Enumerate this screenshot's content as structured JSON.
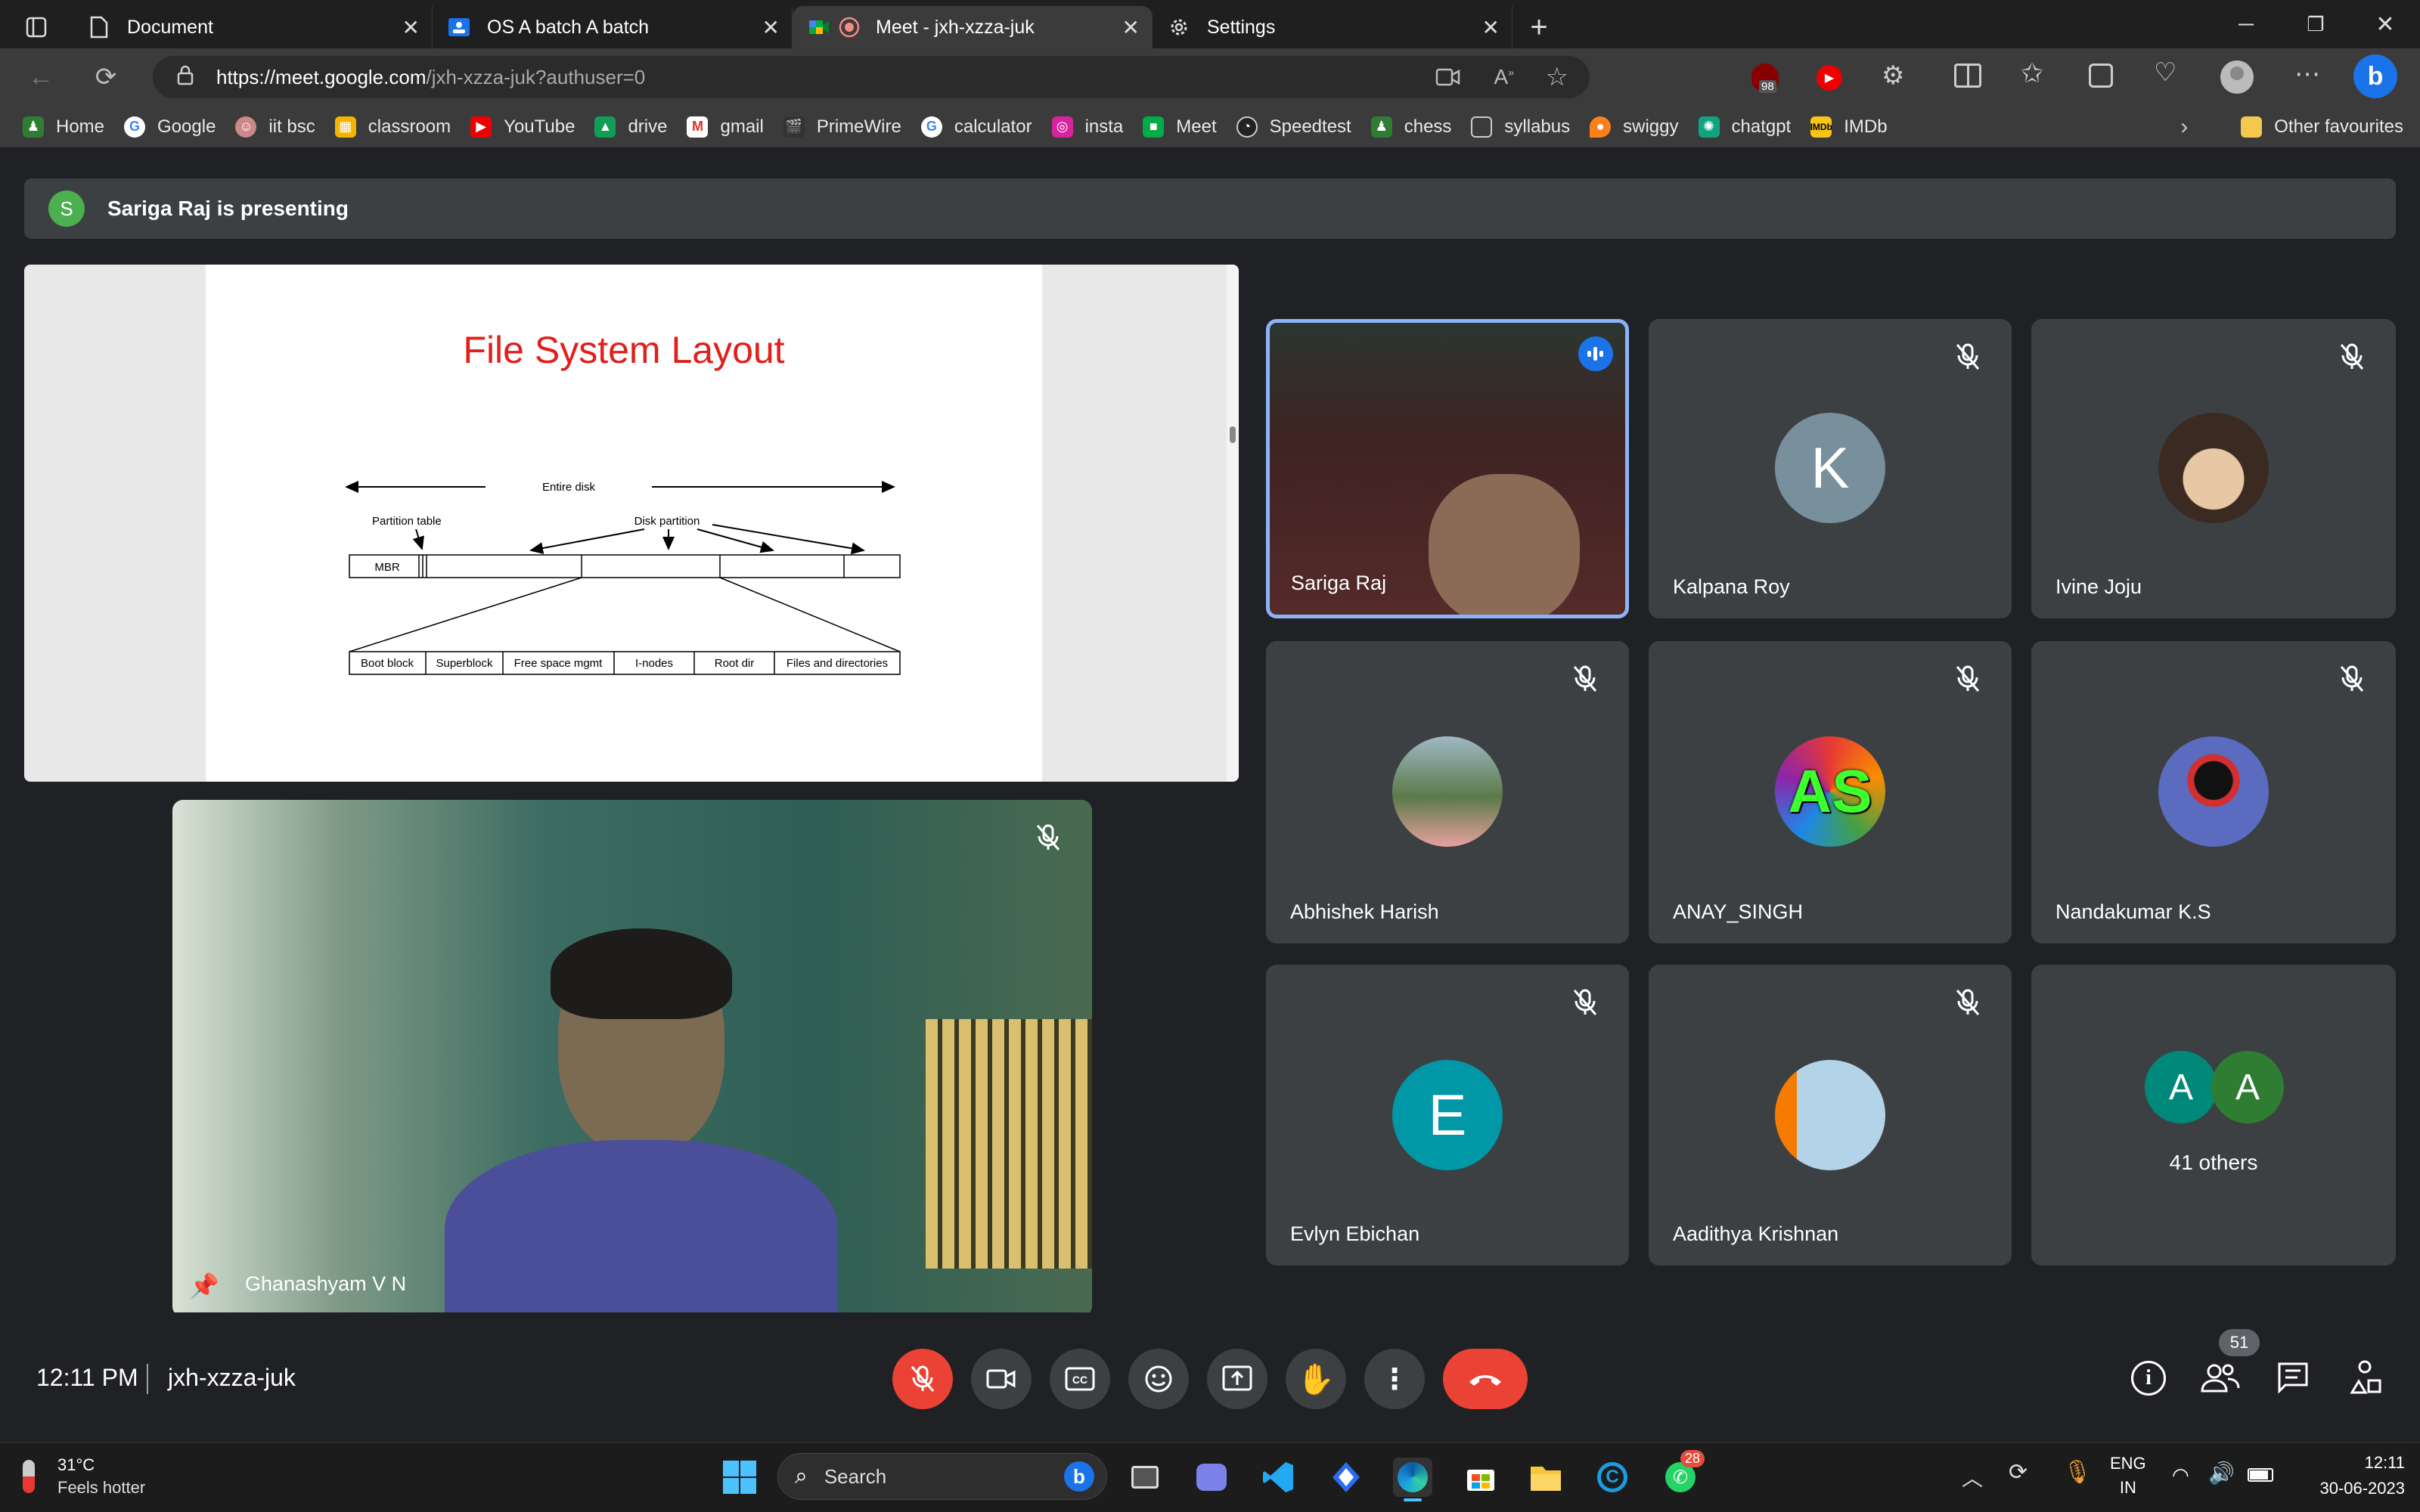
{
  "browser": {
    "tabs": [
      {
        "label": "Document",
        "icon": "document-icon"
      },
      {
        "label": "OS A batch A batch",
        "icon": "classroom-icon"
      },
      {
        "label": "Meet - jxh-xzza-juk",
        "icon": "meet-icon"
      },
      {
        "label": "Settings",
        "icon": "gear-icon"
      }
    ],
    "url_host": "https://meet.google.com",
    "url_path": "/jxh-xzza-juk?authuser=0",
    "ext_badge": "98",
    "bookmarks": [
      "Home",
      "Google",
      "iit bsc",
      "classroom",
      "YouTube",
      "drive",
      "gmail",
      "PrimeWire",
      "calculator",
      "insta",
      "Meet",
      "Speedtest",
      "chess",
      "syllabus",
      "swiggy",
      "chatgpt",
      "IMDb"
    ],
    "other_favourites": "Other favourites"
  },
  "meet": {
    "presenter_initial": "S",
    "presenting_text": "Sariga Raj is presenting",
    "slide": {
      "title": "File System Layout",
      "entire_disk": "Entire disk",
      "partition_table": "Partition table",
      "disk_partition": "Disk partition",
      "mbr": "MBR",
      "blocks": [
        "Boot block",
        "Superblock",
        "Free space mgmt",
        "I-nodes",
        "Root dir",
        "Files and directories"
      ]
    },
    "self_view_name": "Ghanashyam V N",
    "participants": [
      {
        "name": "Sariga Raj",
        "speaking": true
      },
      {
        "name": "Kalpana Roy",
        "initial": "K"
      },
      {
        "name": "Ivine Joju"
      },
      {
        "name": "Abhishek Harish"
      },
      {
        "name": "ANAY_SINGH",
        "initial": "AS"
      },
      {
        "name": "Nandakumar K.S"
      },
      {
        "name": "Evlyn Ebichan",
        "initial": "E"
      },
      {
        "name": "Aadithya Krishnan"
      }
    ],
    "others": {
      "initials": [
        "A",
        "A"
      ],
      "label": "41 others"
    },
    "time": "12:11 PM",
    "meeting_code": "jxh-xzza-juk",
    "people_count": "51"
  },
  "taskbar": {
    "temperature": "31°C",
    "weather": "Feels hotter",
    "search_placeholder": "Search",
    "whatsapp_badge": "28",
    "lang_top": "ENG",
    "lang_bottom": "IN",
    "clock_time": "12:11",
    "clock_date": "30-06-2023"
  },
  "colors": {
    "meet_bg": "#202124",
    "tile_bg": "#3c4043",
    "end_call_red": "#ea4335",
    "speaking_blue": "#8ab4f8",
    "slide_title_red": "#e0201b"
  }
}
